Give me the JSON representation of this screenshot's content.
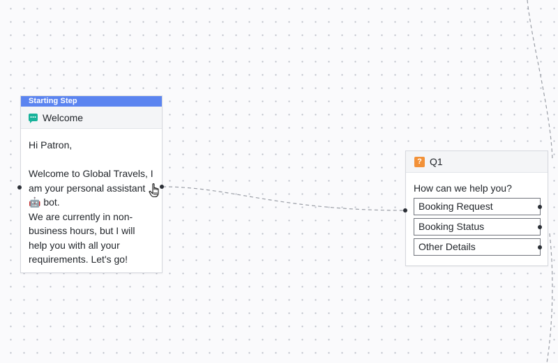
{
  "canvas": {
    "background": "#fafafc",
    "dot_color": "#b8bcc6",
    "edge_color": "#9a9ea6"
  },
  "welcome_node": {
    "badge": "Starting Step",
    "icon": "chat-bubble-icon",
    "title": "Welcome",
    "message": "Hi Patron,\n\nWelcome to Global Travels, I am your personal assistant 🤖 bot.\nWe are currently in non-business hours, but I will help you with all your requirements. Let's go!",
    "badge_color": "#5b84f0",
    "icon_color": "#17b29a"
  },
  "q1_node": {
    "icon": "question-mark-icon",
    "icon_glyph": "?",
    "title": "Q1",
    "question": "How can we help you?",
    "options": [
      {
        "label": "Booking Request"
      },
      {
        "label": "Booking Status"
      },
      {
        "label": "Other Details"
      }
    ],
    "icon_color": "#f29138"
  },
  "cursor": {
    "icon": "hand-pointer-icon"
  }
}
